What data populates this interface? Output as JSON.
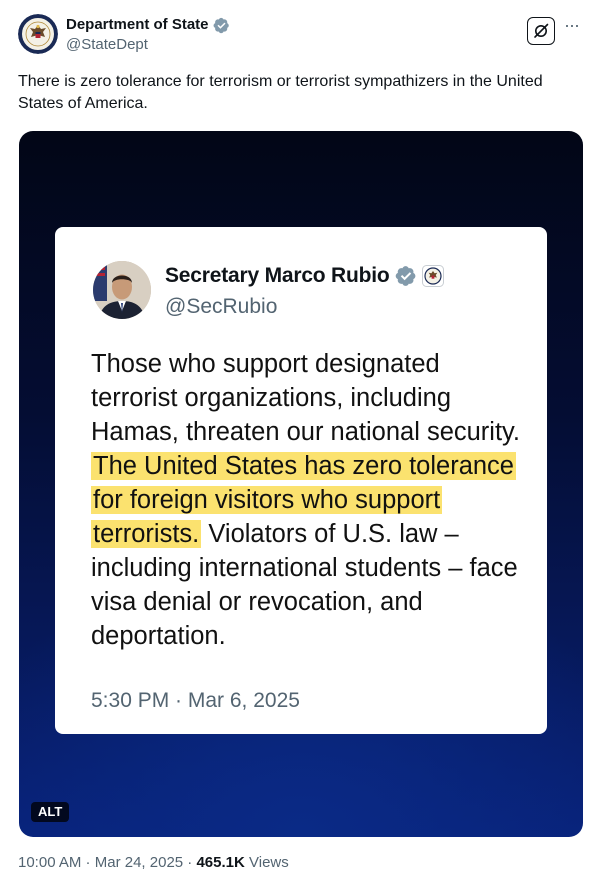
{
  "author": {
    "name": "Department of State",
    "handle": "@StateDept"
  },
  "post": {
    "text": "There is zero tolerance for terrorism or terrorist sympathizers in the United States of America."
  },
  "media": {
    "alt_label": "ALT",
    "card": {
      "name": "Secretary Marco Rubio",
      "handle": "@SecRubio",
      "body_part1": "Those who support designated terrorist organizations, including Hamas, threaten our national security. ",
      "body_highlight": "The United States has zero tolerance for foreign visitors who support terrorists.",
      "body_part2": " Violators of U.S. law – including international students – face visa denial or revocation, and deportation.",
      "timestamp": "5:30 PM · Mar 6, 2025"
    }
  },
  "meta": {
    "time": "10:00 AM",
    "sep1": " · ",
    "date": "Mar 24, 2025",
    "sep2": " · ",
    "views_count": "465.1K",
    "views_label": " Views"
  },
  "icons": {
    "verified": "verified-badge-icon",
    "grok": "grok-icon",
    "more": "more-icon",
    "seal": "department-seal-icon"
  },
  "colors": {
    "highlight": "#fbe26f",
    "verified_badge": "#829aab",
    "media_bg_dark": "#020616",
    "media_bg_blue": "#08227a"
  }
}
